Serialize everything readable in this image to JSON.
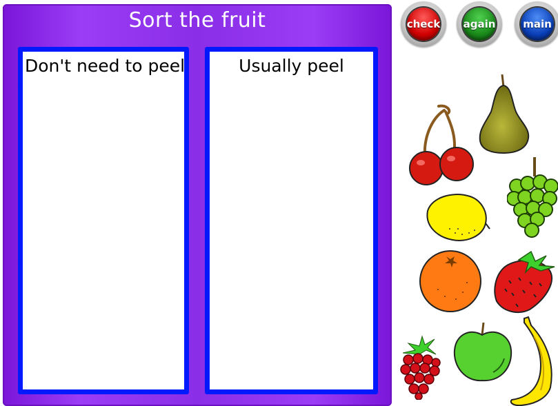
{
  "board": {
    "title": "Sort the fruit",
    "columns": [
      {
        "label": "Don't need to peel"
      },
      {
        "label": "Usually peel"
      }
    ]
  },
  "buttons": {
    "check": "check",
    "again": "again",
    "main": "main"
  },
  "fruits": [
    "pear",
    "cherries",
    "grapes",
    "lemon",
    "orange",
    "strawberry",
    "raspberry",
    "apple",
    "banana"
  ],
  "colors": {
    "board": "#8a2ee8",
    "column_border": "#0019ff",
    "check": "#d10000",
    "again": "#1a8a1a",
    "main": "#0a3fb8"
  }
}
